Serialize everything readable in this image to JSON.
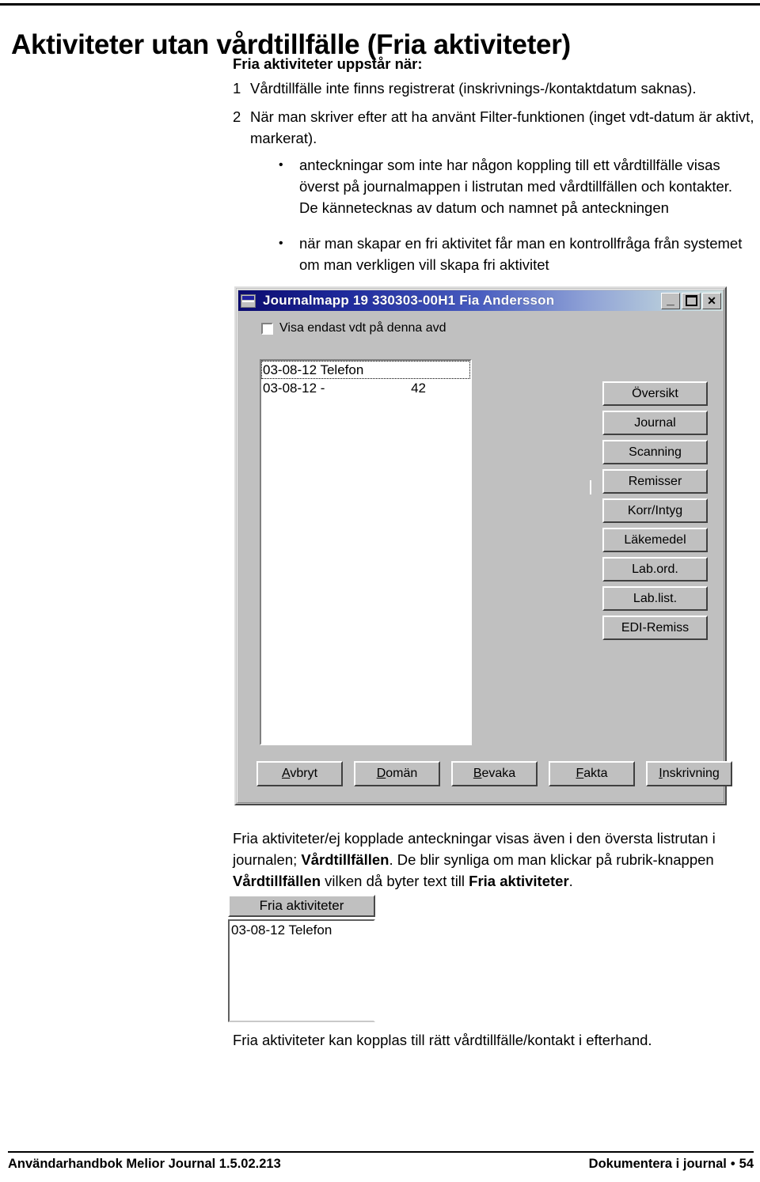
{
  "page": {
    "title": "Aktiviteter utan vårdtillfälle (Fria aktiviteter)",
    "lead": "Fria aktiviteter uppstår när:",
    "numbered_items": [
      {
        "num": "1",
        "text": "Vårdtillfälle inte finns registrerat (inskrivnings-/kontaktdatum saknas)."
      },
      {
        "num": "2",
        "text": "När man skriver efter att ha använt Filter-funktionen (inget vdt-datum är aktivt, markerat)."
      }
    ],
    "bullets": [
      {
        "marker": "•",
        "text": "anteckningar som inte har någon koppling till ett vårdtillfälle visas överst på journalmappen i listrutan med vårdtillfällen och kontakter. De kännetecknas av datum och namnet på anteckningen"
      },
      {
        "marker": "•",
        "text": "när man skapar en fri aktivitet får man en kontrollfråga från systemet om man verkligen vill skapa fri aktivitet"
      }
    ],
    "paragraph2": {
      "part1": "Fria aktiviteter/ej kopplade anteckningar visas även i den översta listrutan i journalen; ",
      "bold1": "Vårdtillfällen",
      "part2": ". De blir synliga om man klickar på rubrik-knappen ",
      "bold2": "Vårdtillfällen",
      "part3": " vilken då byter text till ",
      "bold3": "Fria aktiviteter",
      "part4": "."
    },
    "closing": "Fria aktiviteter kan kopplas till rätt vårdtillfälle/kontakt i efterhand."
  },
  "dialog": {
    "title": "Journalmapp 19 330303-00H1  Fia Andersson",
    "window_buttons": {
      "minimize": "_",
      "maximize": "□",
      "close": "✕"
    },
    "checkbox": {
      "label": "Visa endast vdt på denna avd",
      "checked": false
    },
    "list_rows": [
      {
        "text": "03-08-12 Telefon",
        "value": "",
        "focused": true
      },
      {
        "text": "03-08-12 -",
        "value": "42",
        "focused": false
      }
    ],
    "side_buttons": [
      "Översikt",
      "Journal",
      "Scanning",
      "Remisser",
      "Korr/Intyg",
      "Läkemedel",
      "Lab.ord.",
      "Lab.list.",
      "EDI-Remiss"
    ],
    "bottom_buttons": [
      {
        "accel": "A",
        "rest": "vbryt"
      },
      {
        "accel": "D",
        "rest": "omän"
      },
      {
        "accel": "B",
        "rest": "evaka"
      },
      {
        "accel": "F",
        "rest": "akta"
      },
      {
        "accel": "I",
        "rest": "nskrivning"
      }
    ]
  },
  "widget": {
    "button_label": "Fria aktiviteter",
    "list_rows": [
      {
        "text": "03-08-12 Telefon"
      }
    ]
  },
  "footer": {
    "left": "Användarhandbok Melior Journal 1.5.02.213",
    "right_label": "Dokumentera i journal",
    "separator": "•",
    "page_number": "54"
  },
  "colors": {
    "title_bar_start": "#0b0b6e",
    "title_bar_end": "#cfe0e0",
    "dialog_face": "#c0c0c0",
    "text": "#000000"
  }
}
